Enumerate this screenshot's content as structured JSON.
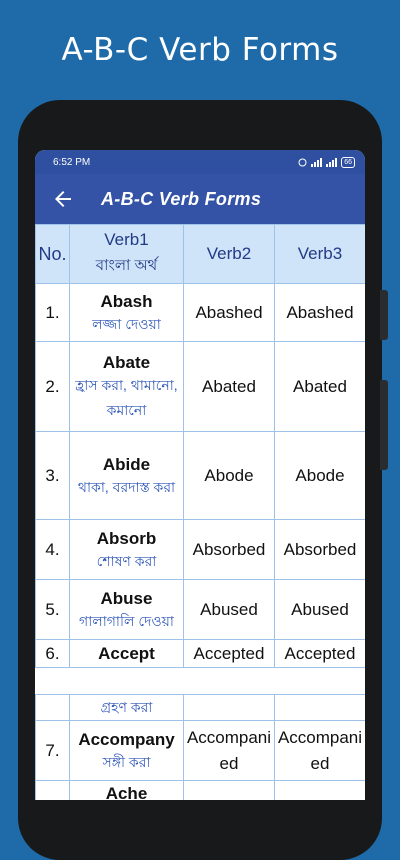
{
  "promo": {
    "title": "A-B-C Verb Forms"
  },
  "status_bar": {
    "time": "6:52 PM",
    "battery": "66"
  },
  "app_bar": {
    "title": "A-B-C Verb Forms",
    "back_icon": "arrow-left-icon"
  },
  "table": {
    "headers": {
      "no": "No.",
      "verb1": "Verb1",
      "verb1_sub": "বাংলা অর্থ",
      "verb2": "Verb2",
      "verb3": "Verb3"
    },
    "rows": [
      {
        "no": "1.",
        "verb1": "Abash",
        "meaning": "লজ্জা দেওয়া",
        "verb2": "Abashed",
        "verb3": "Abashed"
      },
      {
        "no": "2.",
        "verb1": "Abate",
        "meaning": "হ্রাস করা, থামানো, কমানো",
        "verb2": "Abated",
        "verb3": "Abated"
      },
      {
        "no": "3.",
        "verb1": "Abide",
        "meaning": "থাকা, বরদাস্ত করা",
        "verb2": "Abode",
        "verb3": "Abode"
      },
      {
        "no": "4.",
        "verb1": "Absorb",
        "meaning": "শোষণ করা",
        "verb2": "Absorbed",
        "verb3": "Absorbed"
      },
      {
        "no": "5.",
        "verb1": "Abuse",
        "meaning": "গালাগালি দেওয়া",
        "verb2": "Abused",
        "verb3": "Abused"
      },
      {
        "no": "6.",
        "verb1": "Accept",
        "meaning": "গ্রহণ করা",
        "verb2": "Accepted",
        "verb3": "Accepted"
      },
      {
        "no": "7.",
        "verb1": "Accompany",
        "meaning": "সঙ্গী করা",
        "verb2": "Accompanied",
        "verb3": "Accompanied"
      },
      {
        "no": "",
        "verb1": "Ache",
        "meaning": "",
        "verb2": "",
        "verb3": ""
      }
    ]
  }
}
